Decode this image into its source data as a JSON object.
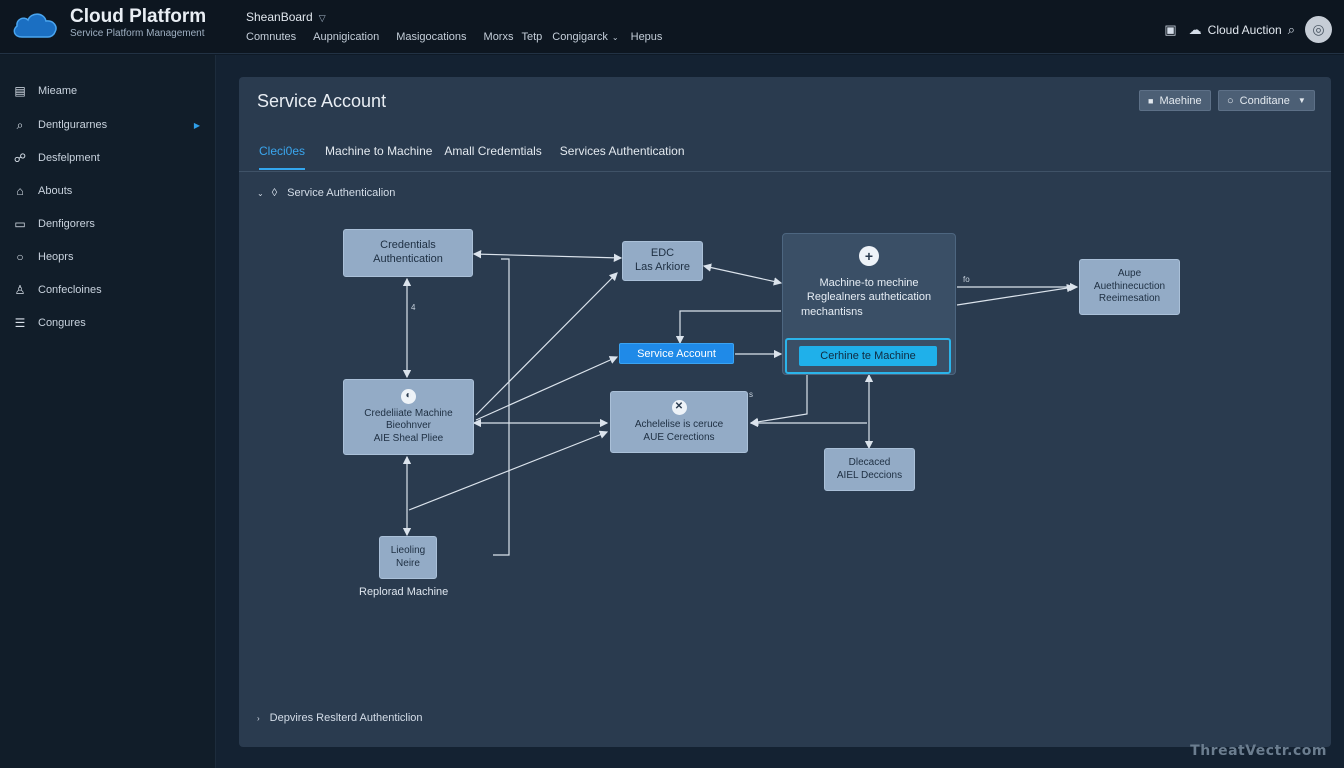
{
  "header": {
    "brand_title": "Cloud Platform",
    "brand_subtitle": "Service Platform Management",
    "workspace": "SheanBoard",
    "nav": [
      "Comnutes",
      "Aupnigication",
      "Masigocations",
      "Morxs",
      "Tetp",
      "Congigarck",
      "Hepus"
    ],
    "account_name": "Cloud Auction"
  },
  "sidebar": {
    "items": [
      {
        "label": "Mieame",
        "icon": "document-icon"
      },
      {
        "label": "Dentlgurarnes",
        "icon": "search-icon"
      },
      {
        "label": "Desfelpment",
        "icon": "link-icon"
      },
      {
        "label": "Abouts",
        "icon": "home-icon"
      },
      {
        "label": "Denfigorers",
        "icon": "message-icon"
      },
      {
        "label": "Heoprs",
        "icon": "circle-icon"
      },
      {
        "label": "Confecloines",
        "icon": "thumbs-up-icon"
      },
      {
        "label": "Congures",
        "icon": "list-icon"
      }
    ]
  },
  "panel": {
    "title": "Service Account",
    "buttons": {
      "machine": "Maehine",
      "conditions": "Conditane"
    },
    "tabs": [
      "Cleci0es",
      "Machine to Machine",
      "Amall Credemtials",
      "Services Authentication"
    ],
    "active_tab": 0,
    "section_header": "Service Authenticalion",
    "section_footer": "Depvires Reslterd Authenticlion"
  },
  "diagram": {
    "nodes": {
      "cred_auth": {
        "line1": "Credentials",
        "line2": "Authentication"
      },
      "edc": {
        "line1": "EDC",
        "line2": "Las Arkiore"
      },
      "machine_panel": {
        "line1": "Machine-to mechine",
        "line2": "Reglealners authetication",
        "line3": "mechantisns",
        "button": "Cerhine te Machine"
      },
      "aupe": {
        "line1": "Aupe",
        "line2": "Auethinecuction",
        "line3": "Reeimesation"
      },
      "service_account_btn": "Service Account",
      "cred_machine": {
        "line1": "Credeliiate Machine",
        "line2": "Bieohnver",
        "line3": "AIE Sheal Pliee"
      },
      "auth_service": {
        "line1": "Achelelise is ceruce",
        "line2": "AUE Cerections"
      },
      "discated": {
        "line1": "Dlecaced",
        "line2": "AIEL Deccions"
      },
      "lieoling": {
        "line1": "Lieoling",
        "line2": "Neire",
        "caption": "Replorad Machine"
      }
    },
    "edge_labels": {
      "a": "4",
      "b": "fo",
      "c": "s"
    }
  },
  "watermark": "ThreatVectr.com",
  "colors": {
    "accent": "#33a6ee",
    "cta": "#1fb0ea",
    "panel": "#2a3b4f",
    "node": "#93abc6"
  }
}
